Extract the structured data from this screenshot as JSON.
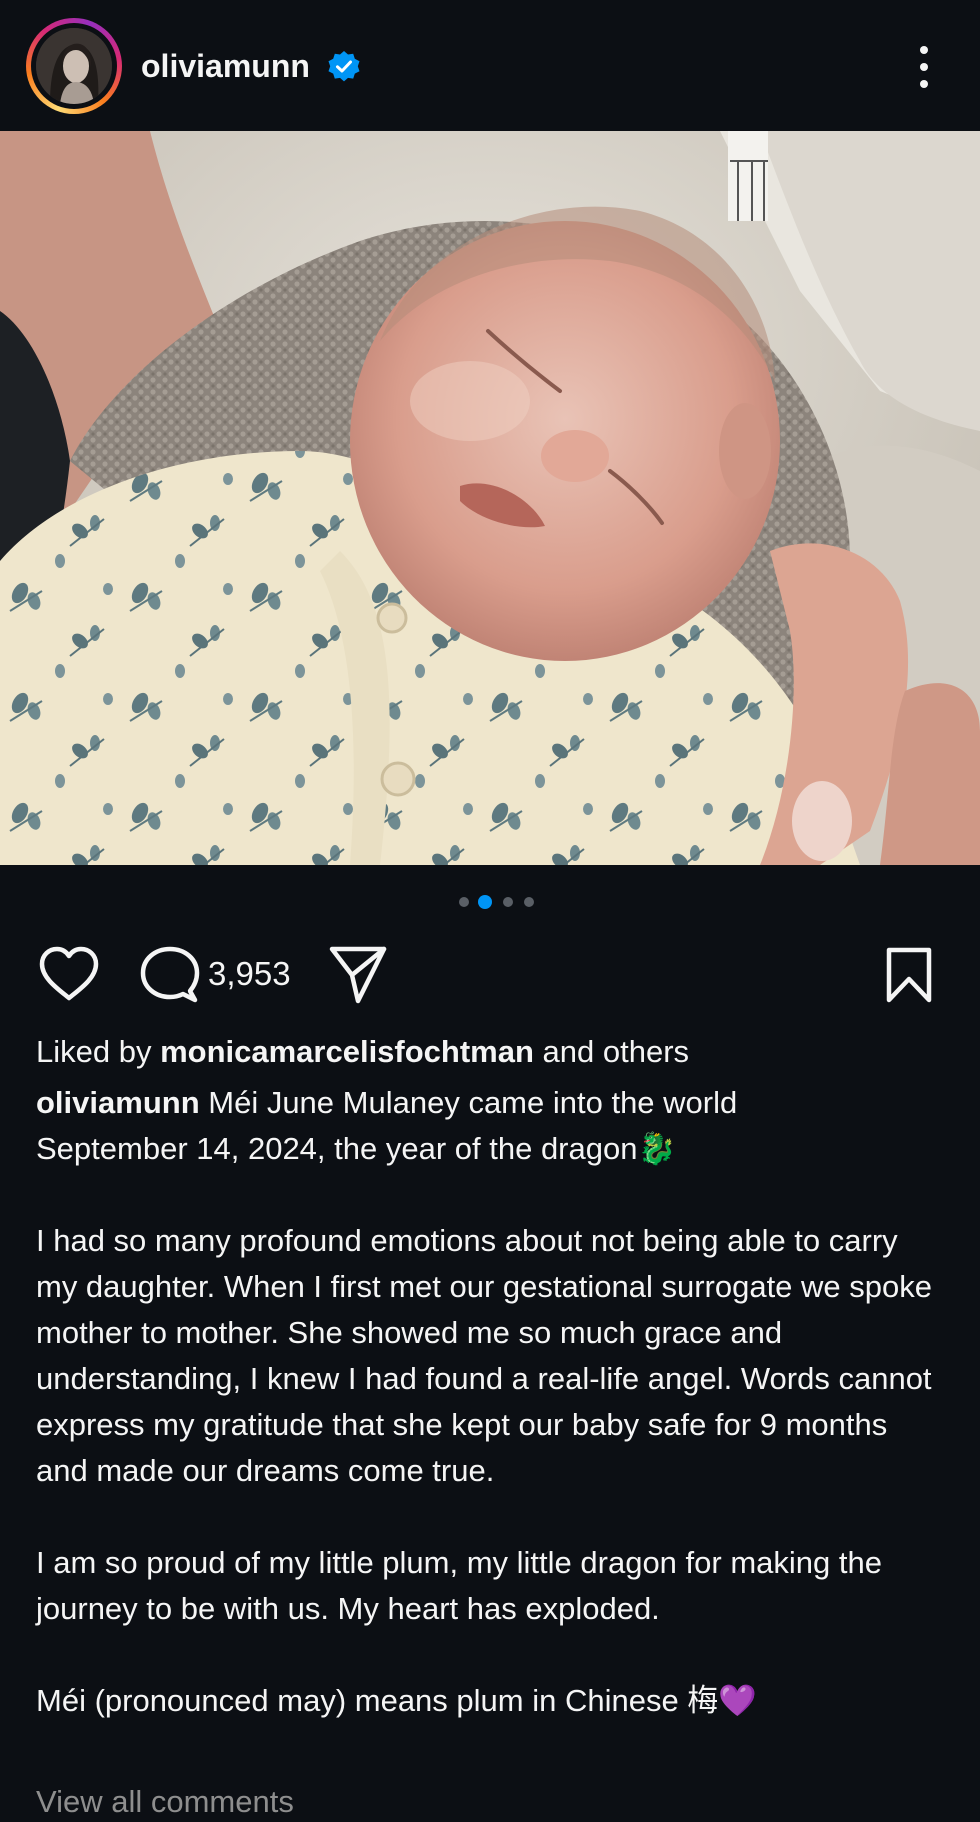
{
  "header": {
    "username": "oliviamunn",
    "verified": true,
    "avatar_icon": "profile-photo",
    "more_icon": "more-vertical-icon"
  },
  "post": {
    "image_description": "newborn-photo",
    "carousel": {
      "total": 4,
      "active_index": 1
    }
  },
  "actions": {
    "like_icon": "heart-icon",
    "comment_icon": "comment-icon",
    "comment_count": "3,953",
    "share_icon": "send-icon",
    "save_icon": "bookmark-icon"
  },
  "likes": {
    "prefix": "Liked by ",
    "user": "monicamarcelisfochtman",
    "suffix": " and others"
  },
  "caption": {
    "user": "oliviamunn",
    "text": " Méi June Mulaney came into the world\nSeptember 14, 2024, the year of the dragon🐉\n\nI had so many profound emotions about not being able to carry my daughter. When I first met our gestational surrogate we spoke mother to mother. She showed me so much grace and understanding, I knew I had found a real-life angel. Words cannot express my gratitude that she kept our baby safe for 9 months and made our dreams come true.\n\nI am so proud of my little plum, my little dragon for making the journey to be with us. My heart has exploded.\n\nMéi (pronounced may) means plum in Chinese 梅💜"
  },
  "footer": {
    "view_comments": "View all comments"
  },
  "colors": {
    "background": "#0c0f14",
    "text": "#f5f5f5",
    "verified_blue": "#0095f6",
    "muted": "#8e8e8e"
  }
}
